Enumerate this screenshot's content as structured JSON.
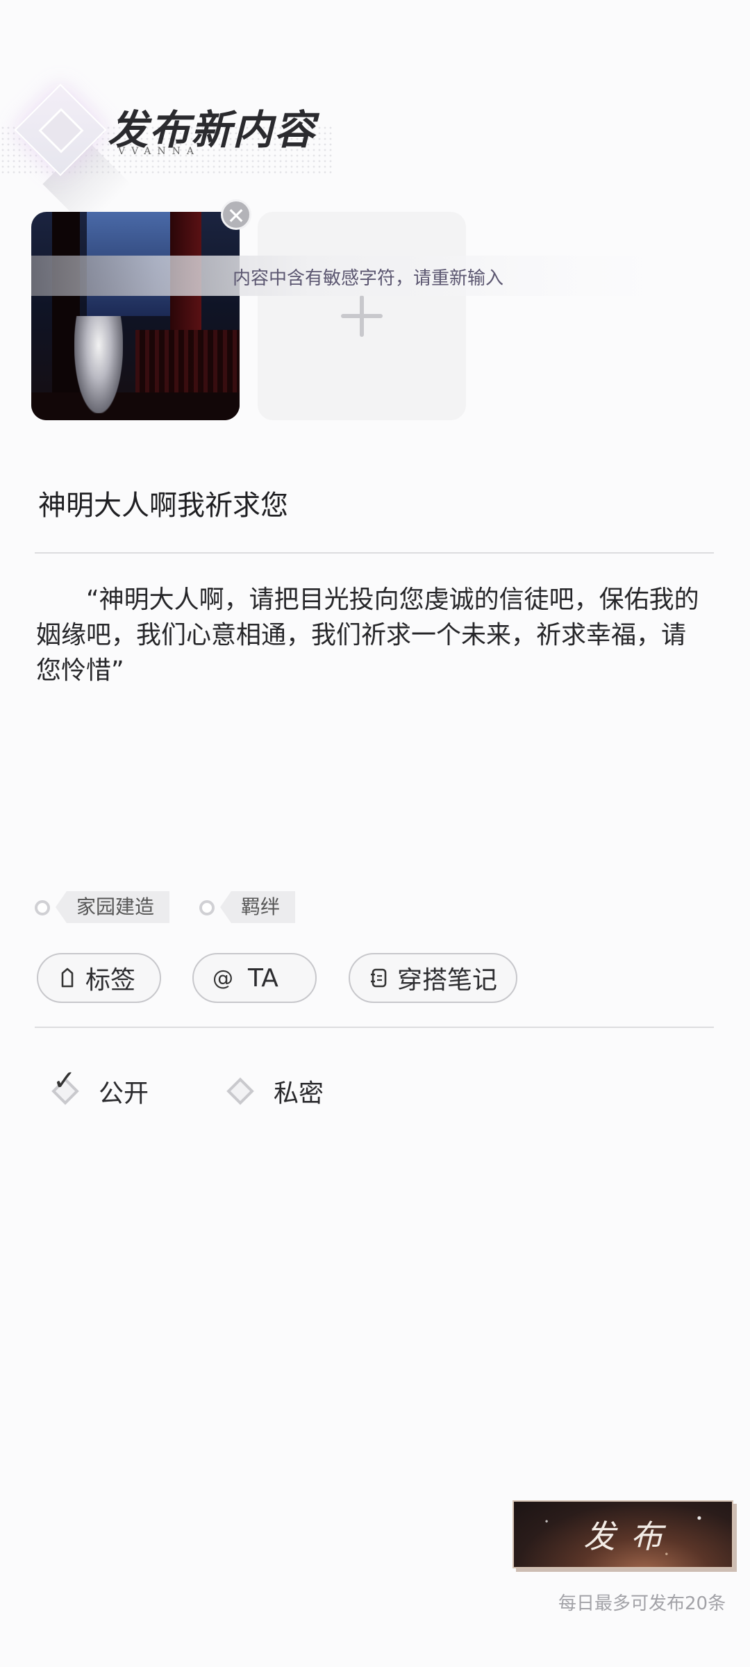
{
  "header": {
    "title": "发布新内容",
    "brand": "VVANNA"
  },
  "toast": {
    "message": "内容中含有敏感字符，请重新输入"
  },
  "images": {
    "remove_symbol": "✕",
    "add_symbol": "+"
  },
  "post": {
    "title": "神明大人啊我祈求您",
    "body": "“神明大人啊，请把目光投向您虔诚的信徒吧，保佑我的姻缘吧，我们心意相通，我们祈求一个未来，祈求幸福，请您怜惜”"
  },
  "topics": [
    {
      "label": "家园建造"
    },
    {
      "label": "羁绊"
    }
  ],
  "actions": [
    {
      "label": "标签",
      "icon": "tag-icon"
    },
    {
      "label": "TA",
      "icon": "at-icon",
      "symbol": "@"
    },
    {
      "label": "穿搭笔记",
      "icon": "notebook-icon"
    }
  ],
  "visibility": {
    "public_label": "公开",
    "private_label": "私密",
    "selected": "public"
  },
  "publish": {
    "label": "发布",
    "limit_note": "每日最多可发布20条"
  }
}
